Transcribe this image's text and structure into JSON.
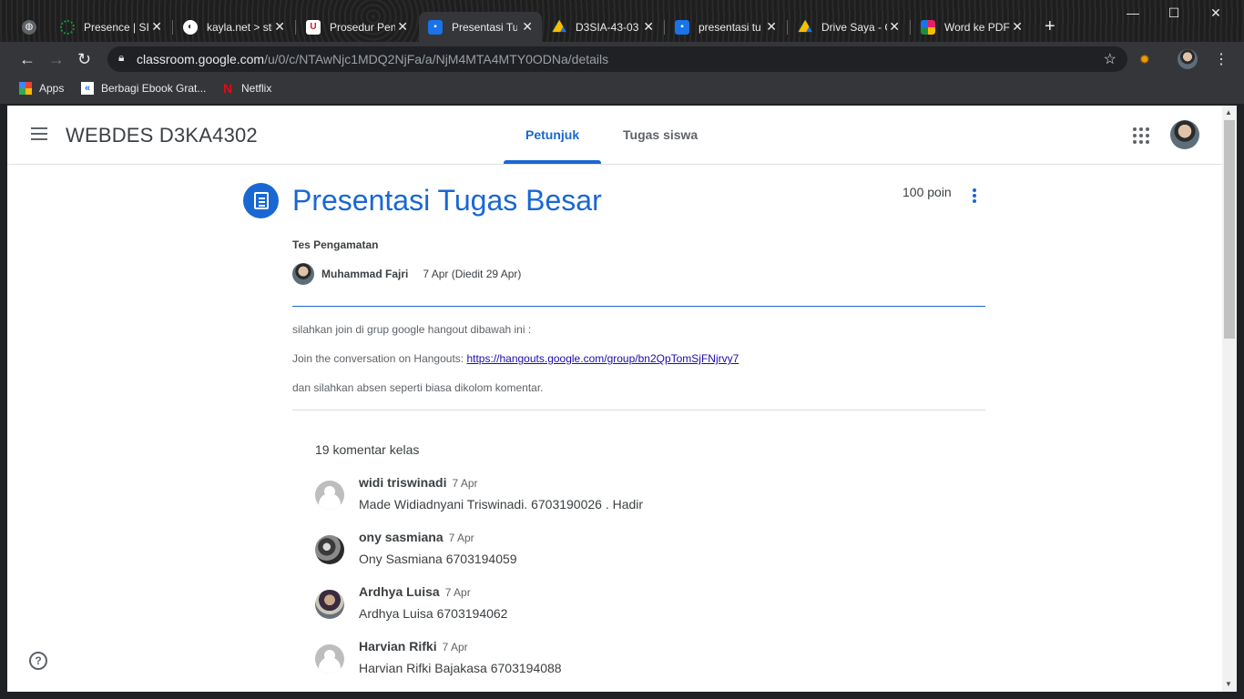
{
  "tabs": [
    {
      "title": "",
      "favicon": "globe-icon",
      "color": "#5f6368"
    },
    {
      "title": "Presence | SIM",
      "favicon": "presence-icon",
      "color": "#1e8e3e"
    },
    {
      "title": "kayla.net > sti",
      "favicon": "kayla-icon",
      "color": "#ffffff"
    },
    {
      "title": "Prosedur Pen",
      "favicon": "shield-icon",
      "color": "#c5221f"
    },
    {
      "title": "Presentasi Tu",
      "favicon": "classroom-icon",
      "color": "#1a73e8"
    },
    {
      "title": "D3SIA-43-03",
      "favicon": "drive-icon",
      "color": "#fbbc04"
    },
    {
      "title": "presentasi tu",
      "favicon": "classroom-icon",
      "color": "#1a73e8"
    },
    {
      "title": "Drive Saya - G",
      "favicon": "drive-icon",
      "color": "#fbbc04"
    },
    {
      "title": "Word ke PDF",
      "favicon": "word-pdf-icon",
      "color": "#e91e63"
    }
  ],
  "url": {
    "host": "classroom.google.com",
    "path": "/u/0/c/NTAwNjc1MDQ2NjFa/a/NjM4MTA4MTY0ODNa/details"
  },
  "bookmarks": [
    {
      "label": "Apps",
      "icon": "apps-grid-icon"
    },
    {
      "label": "Berbagi Ebook Grat...",
      "icon": "ebook-icon"
    },
    {
      "label": "Netflix",
      "icon": "netflix-icon"
    }
  ],
  "classroom": {
    "class_name": "WEBDES D3KA4302",
    "tabs": [
      "Petunjuk",
      "Tugas siswa"
    ]
  },
  "assignment": {
    "title": "Presentasi Tugas Besar",
    "points": "100 poin",
    "subtitle": "Tes Pengamatan",
    "author": "Muhammad Fajri",
    "date": "7 Apr (Diedit 29 Apr)",
    "line1": "silahkan join di grup google hangout dibawah ini :",
    "line2_prefix": "Join the conversation on Hangouts: ",
    "line2_link": "https://hangouts.google.com/group/bn2QpTomSjFNjrvy7",
    "line3": "dan silahkan absen seperti biasa dikolom komentar."
  },
  "comments_header": "19 komentar kelas",
  "comments": [
    {
      "name": "widi triswinadi",
      "date": "7 Apr",
      "text": "Made Widiadnyani Triswinadi. 6703190026 . Hadir",
      "avatar": "grey"
    },
    {
      "name": "ony sasmiana",
      "date": "7 Apr",
      "text": "Ony Sasmiana 6703194059",
      "avatar": "photo1"
    },
    {
      "name": "Ardhya Luisa",
      "date": "7 Apr",
      "text": "Ardhya Luisa 6703194062",
      "avatar": "photo2"
    },
    {
      "name": "Harvian Rifki",
      "date": "7 Apr",
      "text": "Harvian Rifki Bajakasa 6703194088",
      "avatar": "grey"
    }
  ],
  "accent_color": "#1967d2"
}
